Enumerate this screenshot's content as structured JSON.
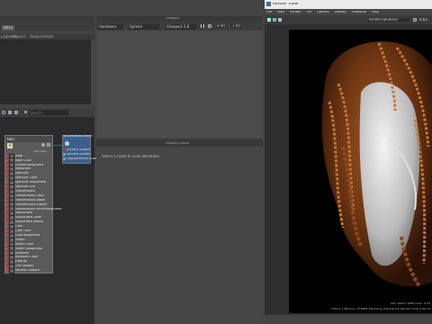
{
  "left_window": {
    "tabs": {
      "active": "Hires",
      "items": [
        "Lightsets",
        "Projects",
        "Asset Presets"
      ]
    },
    "search": {
      "placeholder": "Search..."
    }
  },
  "node_editor": {
    "node_hair": {
      "title": "Hair",
      "header_icon_label": "A",
      "mode_label": "Out Color",
      "attrs": [
        "Base",
        "Base Color",
        "Diffuse Roughness",
        "Metalness",
        "Specular",
        "Specular Color",
        "Specular Roughness",
        "Specular IOR",
        "Transmission",
        "Transmission Color",
        "Transmission Depth",
        "Transmission Scatter",
        "Transmission Extra Roughness",
        "Subsurface",
        "Subsurface Color",
        "Subsurface Radius",
        "Coat",
        "Coat Color",
        "Coat Roughness",
        "Sheen",
        "Sheen Color",
        "Sheen Roughness",
        "Emission",
        "Emission Color",
        "Opacity",
        "Thin Walled",
        "Normal Camera"
      ]
    },
    "node_sg": {
      "title": "aiStandardSurfaceSG",
      "outputs": [
        "Surface Shader",
        "Volume Shader",
        "Displacement Shader"
      ]
    }
  },
  "viewport": {
    "title": "Viewport",
    "menu": [
      "Shading",
      "Lighting",
      "Show",
      "Renderer",
      "Panels"
    ],
    "dropdowns": [
      "Hardware",
      "Sphere",
      "Viewport 2.0",
      "Arnold Renderer"
    ],
    "values": [
      "0.00",
      "1.00"
    ]
  },
  "property_editor": {
    "title": "Property Editor",
    "message": "Select a node to view attributes."
  },
  "render_view": {
    "title": "Render View",
    "menu": [
      "File",
      "View",
      "Render",
      "IPR",
      "Options",
      "Display",
      "Snapshot",
      "Help"
    ],
    "renderer": "Arnold Renderer",
    "zoom": "0.63",
    "status": "Frame: 1   Memory: 3738Mb   Sampling: [3/2/2/2/2/2]   Render Time: 0:00:14",
    "size": "size: 1920 x 1080 zoom: 0.25"
  }
}
